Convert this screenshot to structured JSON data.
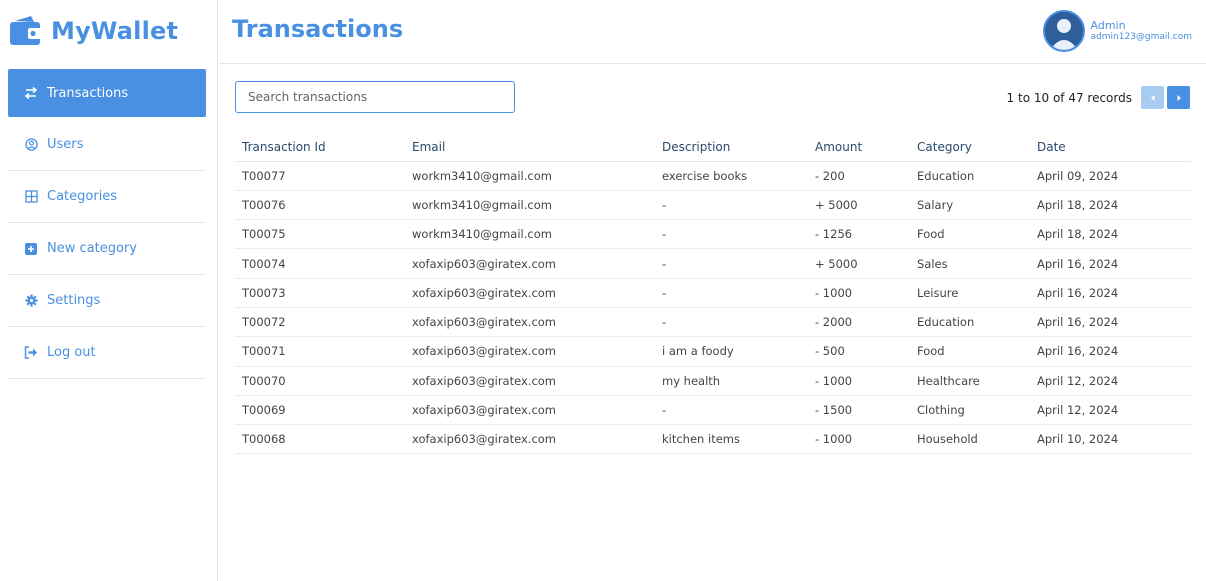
{
  "app": {
    "brand": "MyWallet",
    "accent": "#4a90e2"
  },
  "sidebar": {
    "items": [
      {
        "label": "Transactions",
        "icon": "swap-arrows-icon",
        "active": true
      },
      {
        "label": "Users",
        "icon": "user-circle-icon"
      },
      {
        "label": "Categories",
        "icon": "grid-icon"
      },
      {
        "label": "New category",
        "icon": "plus-square-icon"
      },
      {
        "label": "Settings",
        "icon": "gear-icon"
      },
      {
        "label": "Log out",
        "icon": "logout-icon"
      }
    ]
  },
  "header": {
    "title": "Transactions",
    "user": {
      "name": "Admin",
      "email": "admin123@gmail.com"
    }
  },
  "toolbar": {
    "search_placeholder": "Search transactions",
    "search_value": "",
    "pager_text": "1 to 10 of 47 records"
  },
  "table": {
    "columns": [
      "Transaction Id",
      "Email",
      "Description",
      "Amount",
      "Category",
      "Date"
    ],
    "rows": [
      [
        "T00077",
        "workm3410@gmail.com",
        "exercise books",
        "- 200",
        "Education",
        "April 09, 2024"
      ],
      [
        "T00076",
        "workm3410@gmail.com",
        "-",
        "+ 5000",
        "Salary",
        "April 18, 2024"
      ],
      [
        "T00075",
        "workm3410@gmail.com",
        "-",
        "- 1256",
        "Food",
        "April 18, 2024"
      ],
      [
        "T00074",
        "xofaxip603@giratex.com",
        "-",
        "+ 5000",
        "Sales",
        "April 16, 2024"
      ],
      [
        "T00073",
        "xofaxip603@giratex.com",
        "-",
        "- 1000",
        "Leisure",
        "April 16, 2024"
      ],
      [
        "T00072",
        "xofaxip603@giratex.com",
        "-",
        "- 2000",
        "Education",
        "April 16, 2024"
      ],
      [
        "T00071",
        "xofaxip603@giratex.com",
        "i am a foody",
        "- 500",
        "Food",
        "April 16, 2024"
      ],
      [
        "T00070",
        "xofaxip603@giratex.com",
        "my health",
        "- 1000",
        "Healthcare",
        "April 12, 2024"
      ],
      [
        "T00069",
        "xofaxip603@giratex.com",
        "-",
        "- 1500",
        "Clothing",
        "April 12, 2024"
      ],
      [
        "T00068",
        "xofaxip603@giratex.com",
        "kitchen items",
        "- 1000",
        "Household",
        "April 10, 2024"
      ]
    ]
  }
}
